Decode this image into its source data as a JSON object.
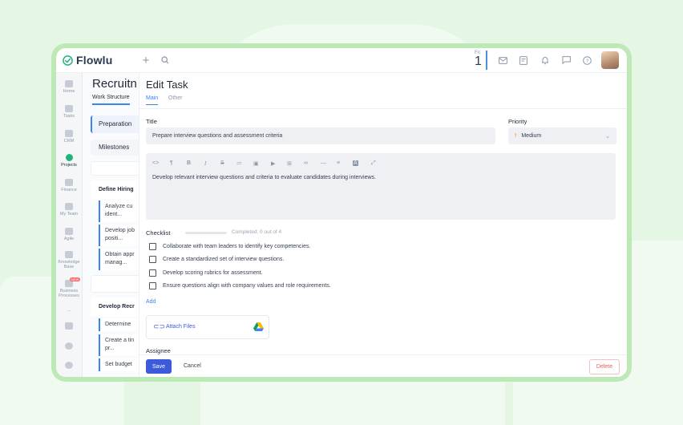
{
  "app": {
    "name": "Flowlu"
  },
  "topbar": {
    "date_dow": "Fri",
    "date_day": "1"
  },
  "sidebar": {
    "items": [
      {
        "label": "Home"
      },
      {
        "label": "Tasks"
      },
      {
        "label": "CRM"
      },
      {
        "label": "Projects"
      },
      {
        "label": "Finance"
      },
      {
        "label": "My Team"
      },
      {
        "label": "Agile"
      },
      {
        "label": "Knowledge Base"
      },
      {
        "label": "Business Processes",
        "badge": "NEW"
      },
      {
        "label": "..."
      }
    ]
  },
  "project": {
    "title": "Recruitn",
    "tab": "Work Structure",
    "preparation": "Preparation",
    "milestones": "Milestones",
    "group1": "Define Hiring",
    "group1_items": [
      "Analyze cu",
      "ident...",
      "Develop job",
      "positi...",
      "Obtain appr",
      "manag..."
    ],
    "group2": "Develop Recr",
    "group2_items": [
      "Determine",
      "Create a tin",
      "pr...",
      "Set budget"
    ]
  },
  "task": {
    "heading": "Edit Task",
    "tabs": [
      "Main",
      "Other"
    ],
    "title_label": "Title",
    "title_value": "Prepare interview questions and assessment criteria",
    "priority_label": "Priority",
    "priority_value": "Medium",
    "description": "Develop relevant interview questions and criteria to evaluate candidates during interviews.",
    "checklist_label": "Checklist",
    "checklist_progress": "Completed: 0 out of 4",
    "checklist_completed_fraction": 0,
    "checklist": [
      "Collaborate with team leaders to identify key competencies.",
      "Create a standardized set of interview questions.",
      "Develop scoring rubrics for assessment.",
      "Ensure questions align with company values and role requirements."
    ],
    "add_label": "Add",
    "attach_label": "Attach Files",
    "assignee_label": "Assignee"
  },
  "footer": {
    "save": "Save",
    "cancel": "Cancel",
    "delete": "Delete"
  },
  "colors": {
    "accent": "#3b5bdb",
    "brand": "#22b37a",
    "danger": "#ef5b5b",
    "frame": "#bde9b7"
  }
}
